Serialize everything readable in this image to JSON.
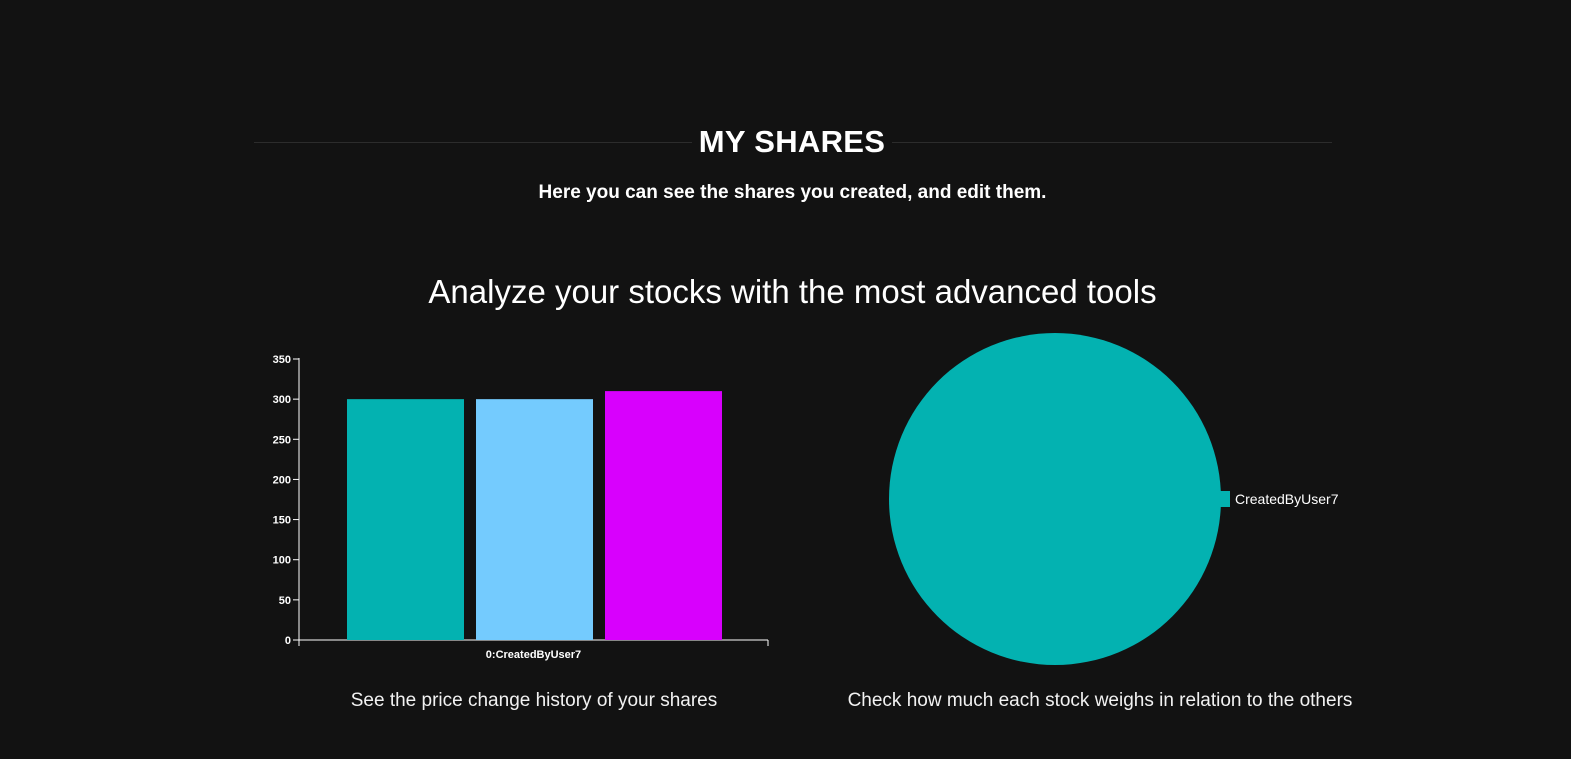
{
  "header": {
    "title": "MY SHARES",
    "subtitle": "Here you can see the shares you created, and edit them.",
    "headline": "Analyze your stocks with the most advanced tools"
  },
  "captions": {
    "bar": "See the price change history of your shares",
    "pie": "Check how much each stock weighs in relation to the others"
  },
  "colors": {
    "background": "#121212",
    "teal": "#03b2b1",
    "light_blue": "#74cbfe",
    "magenta": "#d800fd"
  },
  "chart_data": [
    {
      "type": "bar",
      "categories": [
        "0:CreatedByUser7"
      ],
      "series": [
        {
          "values": [
            300
          ],
          "color": "#03b2b1"
        },
        {
          "values": [
            300
          ],
          "color": "#74cbfe"
        },
        {
          "values": [
            310
          ],
          "color": "#d800fd"
        }
      ],
      "ylim": [
        0,
        350
      ],
      "yticks": [
        0,
        50,
        100,
        150,
        200,
        250,
        300,
        350
      ],
      "grid": false
    },
    {
      "type": "pie",
      "slices": [
        {
          "label": "CreatedByUser7",
          "value": 100,
          "color": "#03b2b1"
        }
      ],
      "legend": "right"
    }
  ]
}
